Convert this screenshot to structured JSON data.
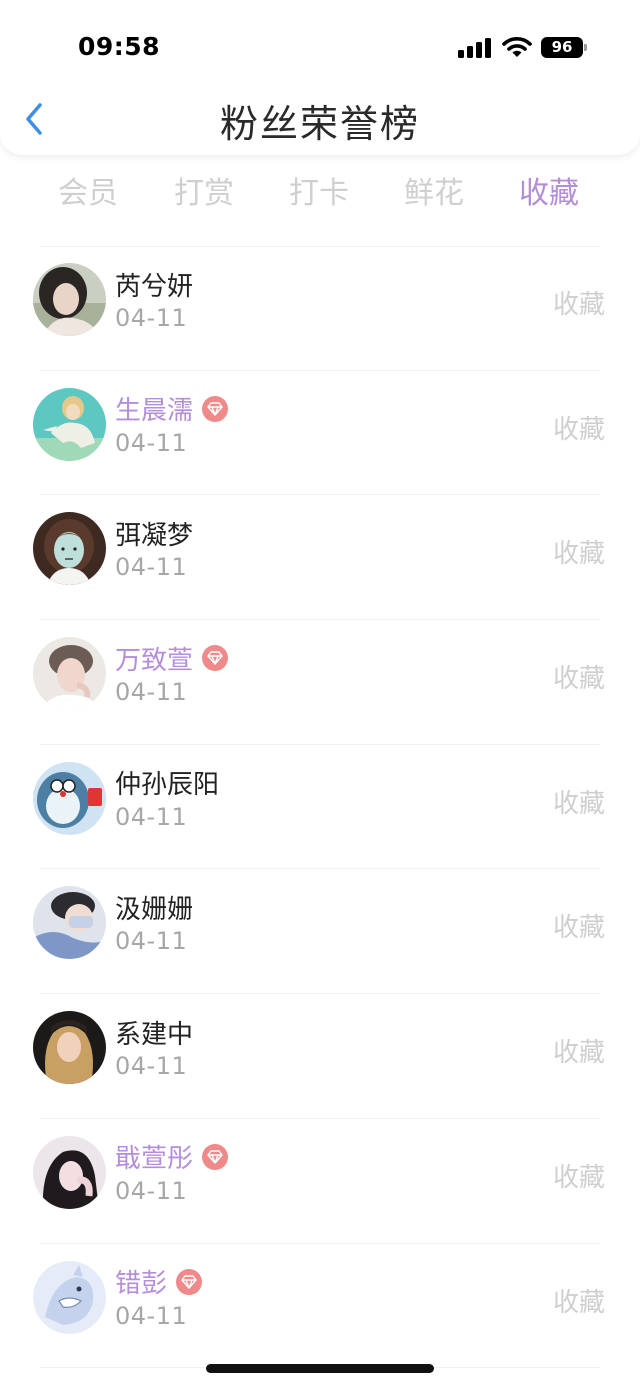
{
  "status_bar": {
    "time": "09:58",
    "battery": "96"
  },
  "header": {
    "title": "粉丝荣誉榜"
  },
  "tabs": [
    {
      "label": "会员",
      "active": false
    },
    {
      "label": "打赏",
      "active": false
    },
    {
      "label": "打卡",
      "active": false
    },
    {
      "label": "鲜花",
      "active": false
    },
    {
      "label": "收藏",
      "active": true
    }
  ],
  "colors": {
    "accent": "#b38ed8",
    "vip_badge": "#f08a8a",
    "inactive": "#cfcfcf"
  },
  "fans": [
    {
      "name": "芮兮妍",
      "date": "04-11",
      "action": "收藏",
      "vip": false,
      "avatar": "photo-girl-icon"
    },
    {
      "name": "生晨濡",
      "date": "04-11",
      "action": "收藏",
      "vip": true,
      "avatar": "anime-boy-icon"
    },
    {
      "name": "弭凝梦",
      "date": "04-11",
      "action": "收藏",
      "vip": false,
      "avatar": "cartoon-girl-icon"
    },
    {
      "name": "万致萱",
      "date": "04-11",
      "action": "收藏",
      "vip": true,
      "avatar": "photo-boy-icon"
    },
    {
      "name": "仲孙辰阳",
      "date": "04-11",
      "action": "收藏",
      "vip": false,
      "avatar": "cartoon-doraemon-icon"
    },
    {
      "name": "汲姗姗",
      "date": "04-11",
      "action": "收藏",
      "vip": false,
      "avatar": "photo-masked-boy-icon"
    },
    {
      "name": "系建中",
      "date": "04-11",
      "action": "收藏",
      "vip": false,
      "avatar": "photo-blonde-girl-icon"
    },
    {
      "name": "戢萱彤",
      "date": "04-11",
      "action": "收藏",
      "vip": true,
      "avatar": "photo-dark-hair-girl-icon"
    },
    {
      "name": "错彭",
      "date": "04-11",
      "action": "收藏",
      "vip": true,
      "avatar": "cartoon-shark-icon"
    }
  ]
}
